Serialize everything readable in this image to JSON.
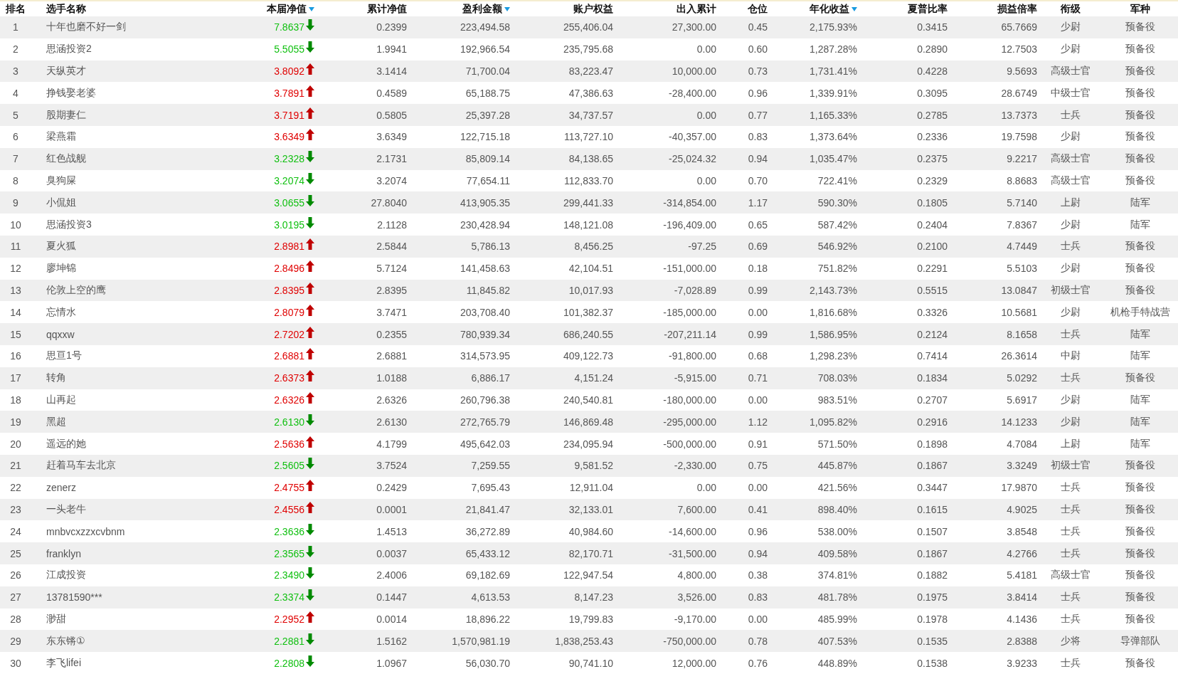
{
  "columns": [
    {
      "label": "排名",
      "sorted": false
    },
    {
      "label": "选手名称",
      "sorted": false
    },
    {
      "label": "本届净值",
      "sorted": true
    },
    {
      "label": "累计净值",
      "sorted": false
    },
    {
      "label": "盈利金额",
      "sorted": true
    },
    {
      "label": "账户权益",
      "sorted": false
    },
    {
      "label": "出入累计",
      "sorted": false
    },
    {
      "label": "仓位",
      "sorted": false
    },
    {
      "label": "年化收益",
      "sorted": true
    },
    {
      "label": "夏普比率",
      "sorted": false
    },
    {
      "label": "损益倍率",
      "sorted": false
    },
    {
      "label": "衔级",
      "sorted": false
    },
    {
      "label": "军种",
      "sorted": false
    }
  ],
  "rows": [
    {
      "rising": false,
      "cells": [
        "1",
        "十年也磨不好一剑",
        "7.8637",
        "0.2399",
        "223,494.58",
        "255,406.04",
        "27,300.00",
        "0.45",
        "2,175.93%",
        "0.3415",
        "65.7669",
        "少尉",
        "预备役"
      ]
    },
    {
      "rising": false,
      "cells": [
        "2",
        "思涵投资2",
        "5.5055",
        "1.9941",
        "192,966.54",
        "235,795.68",
        "0.00",
        "0.60",
        "1,287.28%",
        "0.2890",
        "12.7503",
        "少尉",
        "预备役"
      ]
    },
    {
      "rising": true,
      "cells": [
        "3",
        "天纵英才",
        "3.8092",
        "3.1414",
        "71,700.04",
        "83,223.47",
        "10,000.00",
        "0.73",
        "1,731.41%",
        "0.4228",
        "9.5693",
        "高级士官",
        "预备役"
      ]
    },
    {
      "rising": true,
      "cells": [
        "4",
        "挣钱娶老婆",
        "3.7891",
        "0.4589",
        "65,188.75",
        "47,386.63",
        "-28,400.00",
        "0.96",
        "1,339.91%",
        "0.3095",
        "28.6749",
        "中级士官",
        "预备役"
      ]
    },
    {
      "rising": true,
      "cells": [
        "5",
        "股期妻仁",
        "3.7191",
        "0.5805",
        "25,397.28",
        "34,737.57",
        "0.00",
        "0.77",
        "1,165.33%",
        "0.2785",
        "13.7373",
        "士兵",
        "预备役"
      ]
    },
    {
      "rising": true,
      "cells": [
        "6",
        "梁燕霜",
        "3.6349",
        "3.6349",
        "122,715.18",
        "113,727.10",
        "-40,357.00",
        "0.83",
        "1,373.64%",
        "0.2336",
        "19.7598",
        "少尉",
        "预备役"
      ]
    },
    {
      "rising": false,
      "cells": [
        "7",
        "红色战舰",
        "3.2328",
        "2.1731",
        "85,809.14",
        "84,138.65",
        "-25,024.32",
        "0.94",
        "1,035.47%",
        "0.2375",
        "9.2217",
        "高级士官",
        "预备役"
      ]
    },
    {
      "rising": false,
      "cells": [
        "8",
        "臭狗屎",
        "3.2074",
        "3.2074",
        "77,654.11",
        "112,833.70",
        "0.00",
        "0.70",
        "722.41%",
        "0.2329",
        "8.8683",
        "高级士官",
        "预备役"
      ]
    },
    {
      "rising": false,
      "cells": [
        "9",
        "小侃姐",
        "3.0655",
        "27.8040",
        "413,905.35",
        "299,441.33",
        "-314,854.00",
        "1.17",
        "590.30%",
        "0.1805",
        "5.7140",
        "上尉",
        "陆军"
      ]
    },
    {
      "rising": false,
      "cells": [
        "10",
        "思涵投资3",
        "3.0195",
        "2.1128",
        "230,428.94",
        "148,121.08",
        "-196,409.00",
        "0.65",
        "587.42%",
        "0.2404",
        "7.8367",
        "少尉",
        "陆军"
      ]
    },
    {
      "rising": true,
      "cells": [
        "11",
        "夏火狐",
        "2.8981",
        "2.5844",
        "5,786.13",
        "8,456.25",
        "-97.25",
        "0.69",
        "546.92%",
        "0.2100",
        "4.7449",
        "士兵",
        "预备役"
      ]
    },
    {
      "rising": true,
      "cells": [
        "12",
        "廖坤锦",
        "2.8496",
        "5.7124",
        "141,458.63",
        "42,104.51",
        "-151,000.00",
        "0.18",
        "751.82%",
        "0.2291",
        "5.5103",
        "少尉",
        "预备役"
      ]
    },
    {
      "rising": true,
      "cells": [
        "13",
        "伦敦上空的鹰",
        "2.8395",
        "2.8395",
        "11,845.82",
        "10,017.93",
        "-7,028.89",
        "0.99",
        "2,143.73%",
        "0.5515",
        "13.0847",
        "初级士官",
        "预备役"
      ]
    },
    {
      "rising": true,
      "cells": [
        "14",
        "忘情水",
        "2.8079",
        "3.7471",
        "203,708.40",
        "101,382.37",
        "-185,000.00",
        "0.00",
        "1,816.68%",
        "0.3326",
        "10.5681",
        "少尉",
        "机枪手特战营"
      ]
    },
    {
      "rising": true,
      "cells": [
        "15",
        "qqxxw",
        "2.7202",
        "0.2355",
        "780,939.34",
        "686,240.55",
        "-207,211.14",
        "0.99",
        "1,586.95%",
        "0.2124",
        "8.1658",
        "士兵",
        "陆军"
      ]
    },
    {
      "rising": true,
      "cells": [
        "16",
        "思亘1号",
        "2.6881",
        "2.6881",
        "314,573.95",
        "409,122.73",
        "-91,800.00",
        "0.68",
        "1,298.23%",
        "0.7414",
        "26.3614",
        "中尉",
        "陆军"
      ]
    },
    {
      "rising": true,
      "cells": [
        "17",
        "转角",
        "2.6373",
        "1.0188",
        "6,886.17",
        "4,151.24",
        "-5,915.00",
        "0.71",
        "708.03%",
        "0.1834",
        "5.0292",
        "士兵",
        "预备役"
      ]
    },
    {
      "rising": true,
      "cells": [
        "18",
        "山再起",
        "2.6326",
        "2.6326",
        "260,796.38",
        "240,540.81",
        "-180,000.00",
        "0.00",
        "983.51%",
        "0.2707",
        "5.6917",
        "少尉",
        "陆军"
      ]
    },
    {
      "rising": false,
      "cells": [
        "19",
        "黑超",
        "2.6130",
        "2.6130",
        "272,765.79",
        "146,869.48",
        "-295,000.00",
        "1.12",
        "1,095.82%",
        "0.2916",
        "14.1233",
        "少尉",
        "陆军"
      ]
    },
    {
      "rising": true,
      "cells": [
        "20",
        "遥远的她",
        "2.5636",
        "4.1799",
        "495,642.03",
        "234,095.94",
        "-500,000.00",
        "0.91",
        "571.50%",
        "0.1898",
        "4.7084",
        "上尉",
        "陆军"
      ]
    },
    {
      "rising": false,
      "cells": [
        "21",
        "赶着马车去北京",
        "2.5605",
        "3.7524",
        "7,259.55",
        "9,581.52",
        "-2,330.00",
        "0.75",
        "445.87%",
        "0.1867",
        "3.3249",
        "初级士官",
        "预备役"
      ]
    },
    {
      "rising": true,
      "cells": [
        "22",
        "zenerz",
        "2.4755",
        "0.2429",
        "7,695.43",
        "12,911.04",
        "0.00",
        "0.00",
        "421.56%",
        "0.3447",
        "17.9870",
        "士兵",
        "预备役"
      ]
    },
    {
      "rising": true,
      "cells": [
        "23",
        "一头老牛",
        "2.4556",
        "0.0001",
        "21,841.47",
        "32,133.01",
        "7,600.00",
        "0.41",
        "898.40%",
        "0.1615",
        "4.9025",
        "士兵",
        "预备役"
      ]
    },
    {
      "rising": false,
      "cells": [
        "24",
        "mnbvcxzzxcvbnm",
        "2.3636",
        "1.4513",
        "36,272.89",
        "40,984.60",
        "-14,600.00",
        "0.96",
        "538.00%",
        "0.1507",
        "3.8548",
        "士兵",
        "预备役"
      ]
    },
    {
      "rising": false,
      "cells": [
        "25",
        "franklyn",
        "2.3565",
        "0.0037",
        "65,433.12",
        "82,170.71",
        "-31,500.00",
        "0.94",
        "409.58%",
        "0.1867",
        "4.2766",
        "士兵",
        "预备役"
      ]
    },
    {
      "rising": false,
      "cells": [
        "26",
        "江成投资",
        "2.3490",
        "2.4006",
        "69,182.69",
        "122,947.54",
        "4,800.00",
        "0.38",
        "374.81%",
        "0.1882",
        "5.4181",
        "高级士官",
        "预备役"
      ]
    },
    {
      "rising": false,
      "cells": [
        "27",
        "13781590***",
        "2.3374",
        "0.1447",
        "4,613.53",
        "8,147.23",
        "3,526.00",
        "0.83",
        "481.78%",
        "0.1975",
        "3.8414",
        "士兵",
        "预备役"
      ]
    },
    {
      "rising": true,
      "cells": [
        "28",
        "渺甜",
        "2.2952",
        "0.0014",
        "18,896.22",
        "19,799.83",
        "-9,170.00",
        "0.00",
        "485.99%",
        "0.1978",
        "4.1436",
        "士兵",
        "预备役"
      ]
    },
    {
      "rising": false,
      "cells": [
        "29",
        "东东锵①",
        "2.2881",
        "1.5162",
        "1,570,981.19",
        "1,838,253.43",
        "-750,000.00",
        "0.78",
        "407.53%",
        "0.1535",
        "2.8388",
        "少将",
        "导弹部队"
      ]
    },
    {
      "rising": false,
      "cells": [
        "30",
        "李飞lifei",
        "2.2808",
        "1.0967",
        "56,030.70",
        "90,741.10",
        "12,000.00",
        "0.76",
        "448.89%",
        "0.1538",
        "3.9233",
        "士兵",
        "预备役"
      ]
    }
  ]
}
